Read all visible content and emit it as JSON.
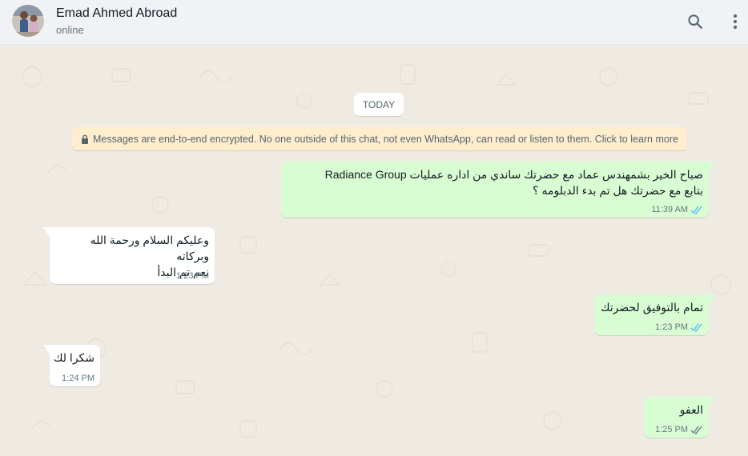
{
  "header": {
    "contact_name": "Emad Ahmed Abroad",
    "status": "online",
    "search_icon": "search-icon",
    "menu_icon": "kebab-menu-icon"
  },
  "chat": {
    "date_label": "TODAY",
    "encryption_notice": "Messages are end-to-end encrypted. No one outside of this chat, not even WhatsApp, can read or listen to them. Click to learn more",
    "messages": [
      {
        "direction": "out",
        "text": "صباح الخير بشمهندس عماد مع حضرتك ساندي من اداره عمليات Radiance Group\nبتابع مع حضرتك هل تم بدء الدبلومه ؟",
        "time": "11:39 AM",
        "status": "read"
      },
      {
        "direction": "in",
        "text": "وعليكم السلام ورحمة الله وبركاته\nنعم تم البدأ",
        "time": "1:23 PM"
      },
      {
        "direction": "out",
        "text": "تمام بالتوفيق لحضرتك",
        "time": "1:23 PM",
        "status": "read"
      },
      {
        "direction": "in",
        "text": "شكرا لك",
        "time": "1:24 PM"
      },
      {
        "direction": "out",
        "text": "العفو",
        "time": "1:25 PM",
        "status": "delivered"
      }
    ]
  },
  "colors": {
    "header_bg": "#f0f2f5",
    "chat_bg": "#efeae2",
    "outgoing_bubble": "#d9fdd3",
    "incoming_bubble": "#ffffff",
    "encryption_bg": "#ffeecd",
    "read_tick": "#53bdeb",
    "delivered_tick": "#667781"
  }
}
